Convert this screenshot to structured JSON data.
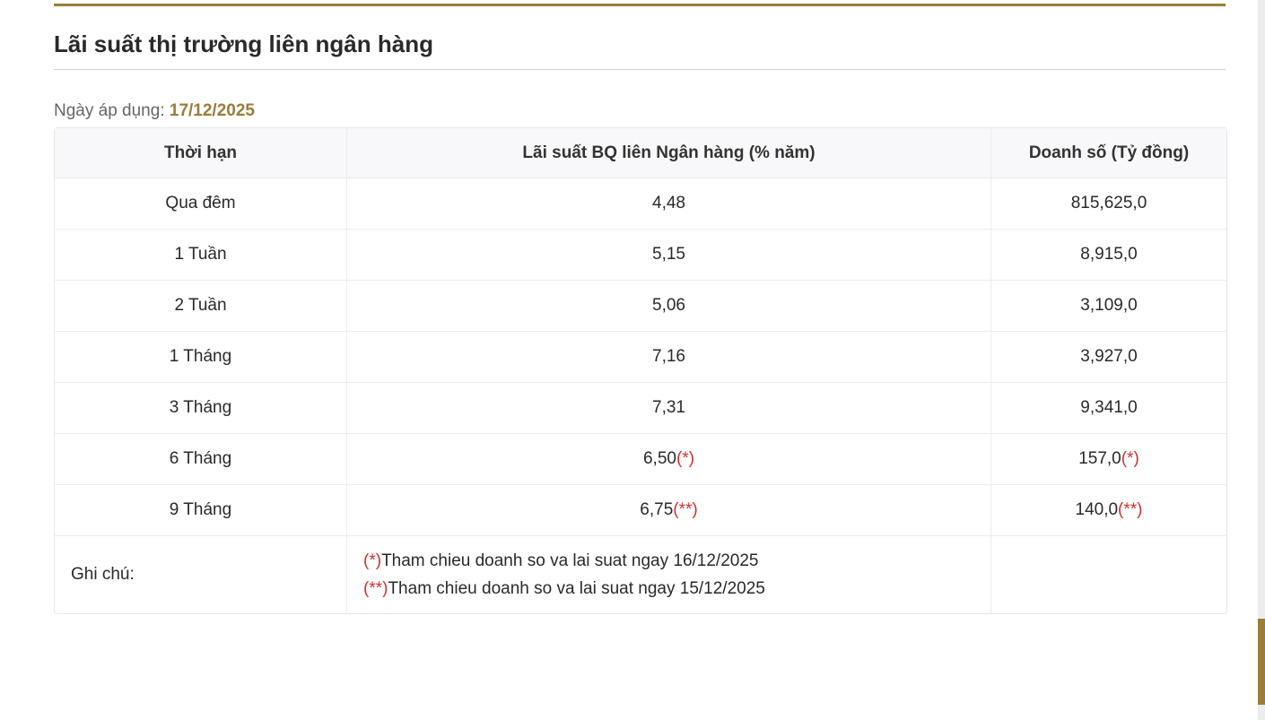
{
  "title": "Lãi suất thị trường liên ngân hàng",
  "applied_label": "Ngày áp dụng:",
  "applied_date": "17/12/2025",
  "table": {
    "headers": [
      "Thời hạn",
      "Lãi suất BQ liên Ngân hàng (% năm)",
      "Doanh số (Tỷ đồng)"
    ],
    "rows": [
      {
        "term": "Qua đêm",
        "rate": "4,48",
        "rate_mark": "",
        "volume": "815,625,0",
        "volume_mark": ""
      },
      {
        "term": "1 Tuần",
        "rate": "5,15",
        "rate_mark": "",
        "volume": "8,915,0",
        "volume_mark": ""
      },
      {
        "term": "2 Tuần",
        "rate": "5,06",
        "rate_mark": "",
        "volume": "3,109,0",
        "volume_mark": ""
      },
      {
        "term": "1 Tháng",
        "rate": "7,16",
        "rate_mark": "",
        "volume": "3,927,0",
        "volume_mark": ""
      },
      {
        "term": "3 Tháng",
        "rate": "7,31",
        "rate_mark": "",
        "volume": "9,341,0",
        "volume_mark": ""
      },
      {
        "term": "6 Tháng",
        "rate": "6,50",
        "rate_mark": "(*)",
        "volume": "157,0",
        "volume_mark": "(*)"
      },
      {
        "term": "9 Tháng",
        "rate": "6,75",
        "rate_mark": "(**)",
        "volume": "140,0",
        "volume_mark": "(**)"
      }
    ],
    "note_label": "Ghi chú:",
    "notes": [
      {
        "mark": "(*)",
        "text": "Tham chieu doanh so va lai suat ngay 16/12/2025"
      },
      {
        "mark": "(**)",
        "text": "Tham chieu doanh so va lai suat ngay 15/12/2025"
      }
    ]
  },
  "colors": {
    "accent": "#9a7d3a",
    "mark": "#d32f2f"
  }
}
